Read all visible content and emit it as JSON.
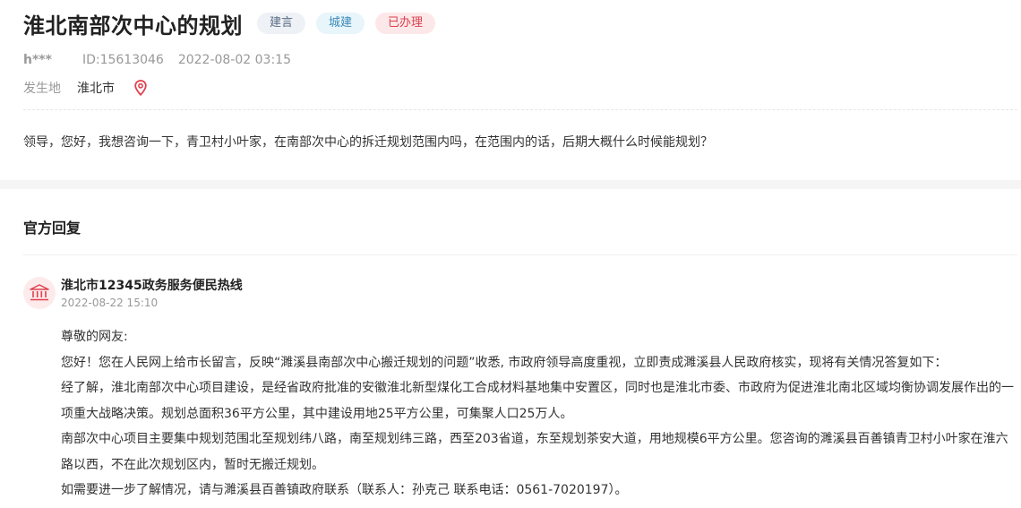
{
  "header": {
    "title": "淮北南部次中心的规划",
    "tags": {
      "type": "建言",
      "category": "城建",
      "status": "已办理"
    },
    "colors": {
      "status_red": "#d9414e",
      "category_blue": "#3b89b8"
    }
  },
  "meta": {
    "user": "h***",
    "id": "ID:15613046",
    "time": "2022-08-02 03:15"
  },
  "location": {
    "label": "发生地",
    "value": "淮北市",
    "icon": "location-pin-icon"
  },
  "message": {
    "content": "领导，您好，我想咨询一下，青卫村小叶家，在南部次中心的拆迁规划范围内吗，在范围内的话，后期大概什么时候能规划？"
  },
  "reply": {
    "section_title": "官方回复",
    "org_icon": "government-building-icon",
    "org_name": "淮北市12345政务服务便民热线",
    "time": "2022-08-22 15:10",
    "paragraphs": [
      "尊敬的网友:",
      "您好！您在人民网上给市长留言，反映“濉溪县南部次中心搬迁规划的问题”收悉, 市政府领导高度重视，立即责成濉溪县人民政府核实，现将有关情况答复如下：",
      "经了解，淮北南部次中心项目建设，是经省政府批准的安徽淮北新型煤化工合成材料基地集中安置区，同时也是淮北市委、市政府为促进淮北南北区域均衡协调发展作出的一项重大战略决策。规划总面积36平方公里，其中建设用地25平方公里，可集聚人口25万人。",
      "南部次中心项目主要集中规划范围北至规划纬八路，南至规划纬三路，西至203省道，东至规划茶安大道，用地规模6平方公里。您咨询的濉溪县百善镇青卫村小叶家在淮六路以西，不在此次规划区内，暂时无搬迁规划。",
      "如需要进一步了解情况，请与濉溪县百善镇政府联系（联系人：孙克己  联系电话：0561-7020197）。"
    ]
  }
}
